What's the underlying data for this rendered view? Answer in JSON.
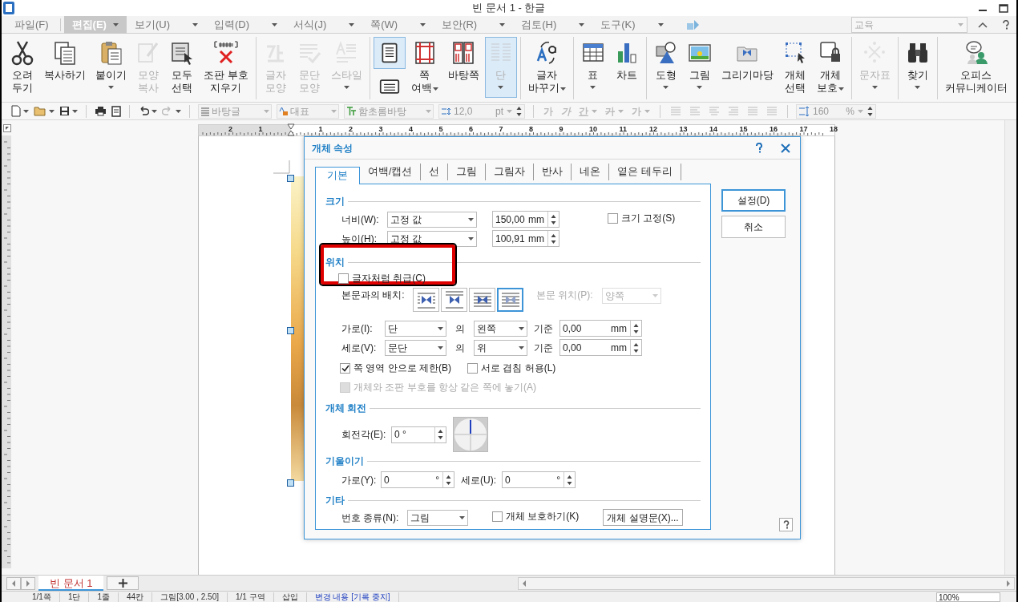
{
  "window": {
    "title": "빈 문서 1 - 한글"
  },
  "menu": {
    "tabs": [
      {
        "label": "파일(F)",
        "selected": false,
        "dropdown": false
      },
      {
        "label": "편집(E)",
        "selected": true,
        "dropdown": true
      },
      {
        "label": "보기(U)",
        "selected": false,
        "dropdown": true
      },
      {
        "label": "입력(D)",
        "selected": false,
        "dropdown": true
      },
      {
        "label": "서식(J)",
        "selected": false,
        "dropdown": true
      },
      {
        "label": "쪽(W)",
        "selected": false,
        "dropdown": true
      },
      {
        "label": "보안(R)",
        "selected": false,
        "dropdown": true
      },
      {
        "label": "검토(H)",
        "selected": false,
        "dropdown": true
      },
      {
        "label": "도구(K)",
        "selected": false,
        "dropdown": true
      }
    ],
    "search": {
      "placeholder": "교육"
    }
  },
  "ribbon": {
    "groups": [
      {
        "items": [
          {
            "kind": "button",
            "label": "오려\n두기",
            "disabled": false,
            "selected": false,
            "dropdown": false
          },
          {
            "kind": "button",
            "label": "복사하기",
            "disabled": false,
            "selected": false,
            "dropdown": false
          },
          {
            "kind": "button",
            "label": "붙이기",
            "disabled": false,
            "selected": false,
            "dropdown": true
          },
          {
            "kind": "button",
            "label": "모양\n복사",
            "disabled": true,
            "selected": false,
            "dropdown": false
          },
          {
            "kind": "button",
            "label": "모두\n선택",
            "disabled": false,
            "selected": false,
            "dropdown": false
          },
          {
            "kind": "button",
            "label": "조판 부호\n지우기",
            "disabled": false,
            "selected": false,
            "dropdown": false
          }
        ]
      },
      {
        "items": [
          {
            "kind": "button",
            "label": "글자\n모양",
            "disabled": true,
            "selected": false,
            "dropdown": false
          },
          {
            "kind": "button",
            "label": "문단\n모양",
            "disabled": true,
            "selected": false,
            "dropdown": false
          },
          {
            "kind": "button",
            "label": "스타일",
            "disabled": true,
            "selected": false,
            "dropdown": true
          }
        ]
      },
      {
        "items": [
          {
            "kind": "stack",
            "disabled": false,
            "selected": true,
            "dropdown": false
          },
          {
            "kind": "button",
            "label": "쪽\n여백",
            "disabled": false,
            "selected": false,
            "dropdown": true
          },
          {
            "kind": "button",
            "label": "바탕쪽",
            "disabled": false,
            "selected": false,
            "dropdown": false
          },
          {
            "kind": "button",
            "label": "단",
            "disabled": true,
            "selected": true,
            "dropdown": true
          }
        ]
      },
      {
        "items": [
          {
            "kind": "button",
            "label": "글자\n바꾸기",
            "disabled": false,
            "selected": false,
            "dropdown": true
          }
        ]
      },
      {
        "items": [
          {
            "kind": "button",
            "label": "표",
            "disabled": false,
            "selected": false,
            "dropdown": true
          },
          {
            "kind": "button",
            "label": "차트",
            "disabled": false,
            "selected": false,
            "dropdown": false
          }
        ]
      },
      {
        "items": [
          {
            "kind": "button",
            "label": "도형",
            "disabled": false,
            "selected": false,
            "dropdown": true
          },
          {
            "kind": "button",
            "label": "그림",
            "disabled": false,
            "selected": false,
            "dropdown": true
          },
          {
            "kind": "button",
            "label": "그리기마당",
            "disabled": false,
            "selected": false,
            "dropdown": false
          },
          {
            "kind": "button",
            "label": "개체\n선택",
            "disabled": false,
            "selected": false,
            "dropdown": false
          },
          {
            "kind": "button",
            "label": "개체\n보호",
            "disabled": false,
            "selected": false,
            "dropdown": true
          }
        ]
      },
      {
        "items": [
          {
            "kind": "button",
            "label": "문자표",
            "disabled": true,
            "selected": false,
            "dropdown": true
          }
        ]
      },
      {
        "items": [
          {
            "kind": "button",
            "label": "찾기",
            "disabled": false,
            "selected": false,
            "dropdown": true
          }
        ]
      },
      {
        "items": [
          {
            "kind": "button",
            "label": "오피스\n커뮤니케이터",
            "disabled": false,
            "selected": false,
            "dropdown": false
          }
        ]
      }
    ]
  },
  "toolbar": {
    "style": "바탕글",
    "language": "대표",
    "font": "함초롬바탕",
    "size": "12,0",
    "size_unit": "pt",
    "char_buttons": [
      "가",
      "가",
      "간",
      "가",
      "가"
    ],
    "line_spacing": "160",
    "line_spacing_unit": "%"
  },
  "ruler": {
    "left_numbers": [
      "2",
      "1"
    ],
    "right_numbers": [
      "1",
      "2",
      "3",
      "4",
      "5",
      "6",
      "7",
      "8",
      "9",
      "10",
      "11",
      "12",
      "13",
      "14",
      "15",
      "16",
      "17",
      "18"
    ]
  },
  "dialog": {
    "title": "개체 속성",
    "tabs": [
      {
        "label": "기본",
        "selected": true
      },
      {
        "label": "여백/캡션",
        "selected": false
      },
      {
        "label": "선",
        "selected": false
      },
      {
        "label": "그림",
        "selected": false
      },
      {
        "label": "그림자",
        "selected": false
      },
      {
        "label": "반사",
        "selected": false
      },
      {
        "label": "네온",
        "selected": false
      },
      {
        "label": "옅은 테두리",
        "selected": false
      }
    ],
    "buttons": [
      "설정(D)",
      "취소"
    ],
    "size": {
      "heading": "크기",
      "width": {
        "label": "너비(W):",
        "mode": "고정 값",
        "value": "150,00",
        "unit": "mm"
      },
      "height": {
        "label": "높이(H):",
        "mode": "고정 값",
        "value": "100,91",
        "unit": "mm"
      },
      "lock": {
        "label": "크기 고정(S)",
        "checked": false
      }
    },
    "position": {
      "heading": "위치",
      "as_char": {
        "label": "글자처럼 취급(C)",
        "checked": false,
        "highlighted": true
      },
      "wrap_label": "본문과의 배치:",
      "wrap_options": [
        {
          "selected": false
        },
        {
          "selected": false
        },
        {
          "selected": false
        },
        {
          "selected": true
        }
      ],
      "text_pos_label": "본문 위치(P):",
      "text_pos_value": "양쪽",
      "horizontal": {
        "label": "가로(I):",
        "ref": "단",
        "of": "의",
        "anchor": "왼쪽",
        "base": "기준",
        "value": "0,00",
        "unit": "mm"
      },
      "vertical": {
        "label": "세로(V):",
        "ref": "문단",
        "of": "의",
        "anchor": "위",
        "base": "기준",
        "value": "0,00",
        "unit": "mm"
      },
      "checks": [
        {
          "label": "쪽 영역 안으로 제한(B)",
          "checked": true,
          "disabled": false
        },
        {
          "label": "서로 겹침 허용(L)",
          "checked": false,
          "disabled": false
        }
      ],
      "same_page": {
        "label": "개체와 조판 부호를 항상 같은 쪽에 놓기(A)",
        "checked": false,
        "disabled": true
      }
    },
    "rotation": {
      "heading": "개체 회전",
      "label": "회전각(E):",
      "value": "0",
      "unit": "°"
    },
    "skew": {
      "heading": "기울이기",
      "h_label": "가로(Y):",
      "h_value": "0",
      "v_label": "세로(U):",
      "v_value": "0",
      "unit": "°"
    },
    "other": {
      "heading": "기타",
      "number_label": "번호 종류(N):",
      "number_value": "그림",
      "protect": {
        "label": "개체 보호하기(K)",
        "checked": false
      },
      "desc_button": "개체 설명문(X)..."
    }
  },
  "doc_tabs": [
    {
      "label": "빈 문서 1",
      "selected": true
    }
  ],
  "status_bar": [
    {
      "text": "1/1쪽",
      "kind": "text"
    },
    {
      "text": "1단",
      "kind": "text"
    },
    {
      "text": "1줄",
      "kind": "text"
    },
    {
      "text": "44칸",
      "kind": "text"
    },
    {
      "text": "그림[3.00 , 2.50]",
      "kind": "text"
    },
    {
      "text": "1/1 구역",
      "kind": "text"
    },
    {
      "text": "삽입",
      "kind": "text"
    },
    {
      "text": "변경 내용 [기록 중지]",
      "kind": "link"
    }
  ],
  "zoom": "100%"
}
